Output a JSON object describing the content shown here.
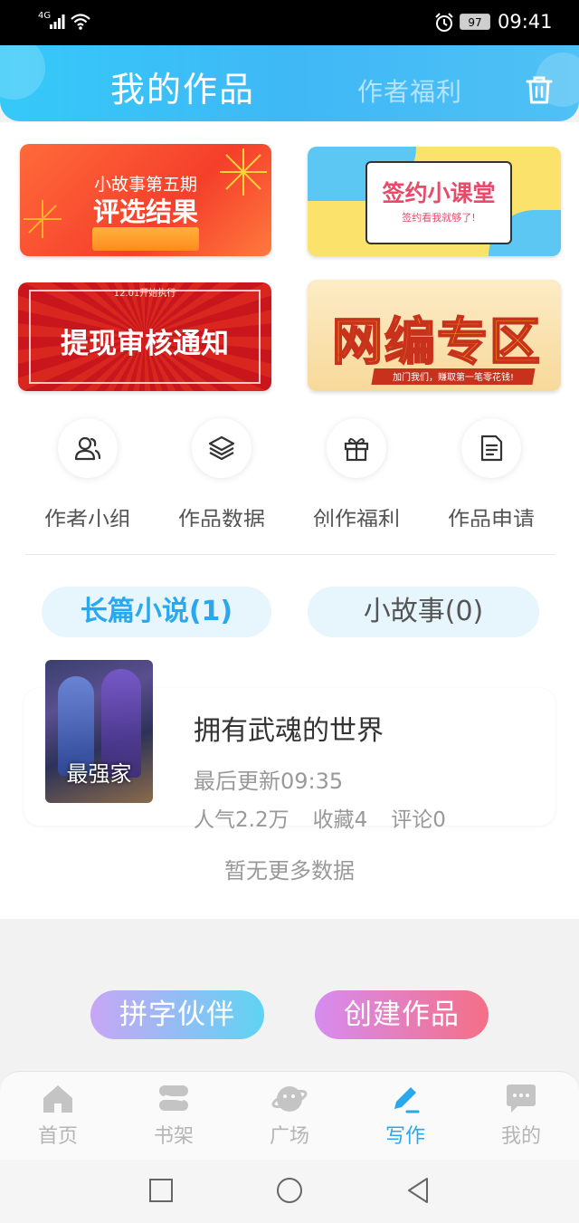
{
  "status_bar": {
    "network": "4G",
    "battery": "97",
    "time": "09:41"
  },
  "header": {
    "title": "我的作品",
    "tab2": "作者福利"
  },
  "banners": [
    {
      "line1": "小故事第五期",
      "line2": "评选结果"
    },
    {
      "title": "签约小课堂",
      "subtitle": "签约看我就够了!"
    },
    {
      "small": "12.01开始执行",
      "title": "提现审核通知"
    },
    {
      "title": "网编专区",
      "small": "加门我们，赚取第一笔零花钱!"
    }
  ],
  "quick_actions": [
    {
      "label": "作者小组",
      "icon": "users-icon"
    },
    {
      "label": "作品数据",
      "icon": "layers-icon"
    },
    {
      "label": "创作福利",
      "icon": "gift-icon"
    },
    {
      "label": "作品申请",
      "icon": "document-icon"
    }
  ],
  "tabs": [
    {
      "label": "长篇小说(1)"
    },
    {
      "label": "小故事(0)"
    }
  ],
  "book": {
    "title": "拥有武魂的世界",
    "updated": "最后更新09:35",
    "popularity": "人气2.2万",
    "favorites": "收藏4",
    "comments": "评论0",
    "cover_text": "最强家"
  },
  "no_more": "暂无更多数据",
  "actions": {
    "partner": "拼字伙伴",
    "create": "创建作品"
  },
  "bottom_nav": [
    {
      "label": "首页",
      "icon": "home-icon"
    },
    {
      "label": "书架",
      "icon": "bookshelf-icon"
    },
    {
      "label": "广场",
      "icon": "planet-icon"
    },
    {
      "label": "写作",
      "icon": "pen-icon"
    },
    {
      "label": "我的",
      "icon": "chat-icon"
    }
  ],
  "colors": {
    "accent": "#2aa8ee",
    "header": "#3fb8f6",
    "partner_grad": [
      "#c8a6f5",
      "#5fd3f3"
    ],
    "create_grad": [
      "#d68cf0",
      "#f46f86"
    ]
  }
}
